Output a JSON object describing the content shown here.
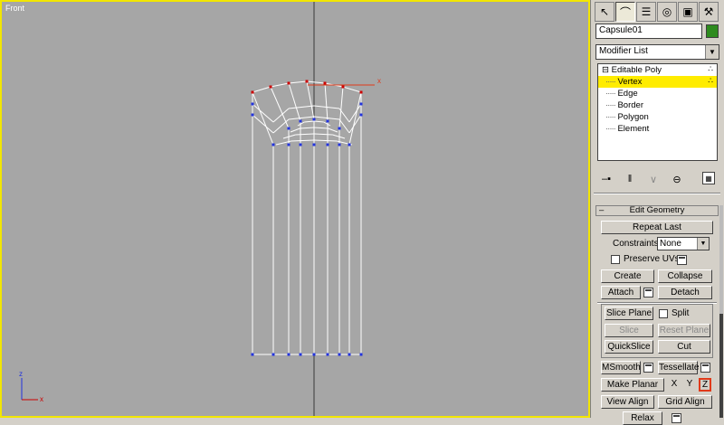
{
  "viewport": {
    "label": "Front",
    "axis_labels": {
      "x": "x",
      "gizmo_x": "x",
      "gizmo_z": "z"
    }
  },
  "panel": {
    "tabs": [
      "create-icon",
      "modify-icon",
      "hierarchy-icon",
      "motion-icon",
      "display-icon",
      "utilities-icon"
    ],
    "object_name": "Capsule01",
    "object_color": "#2e8b1e",
    "modifier_list": "Modifier List",
    "stack": {
      "root": "Editable Poly",
      "items": [
        "Vertex",
        "Edge",
        "Border",
        "Polygon",
        "Element"
      ],
      "selected": "Vertex"
    },
    "rollout": {
      "title": "Edit Geometry",
      "repeat_last": "Repeat Last",
      "constraints_label": "Constraints:",
      "constraints_value": "None",
      "preserve_uvs": "Preserve UVs",
      "create": "Create",
      "collapse": "Collapse",
      "attach": "Attach",
      "detach": "Detach",
      "slice_plane": "Slice Plane",
      "split": "Split",
      "slice": "Slice",
      "reset_plane": "Reset Plane",
      "quickslice": "QuickSlice",
      "cut": "Cut",
      "msmooth": "MSmooth",
      "tessellate": "Tessellate",
      "make_planar": "Make Planar",
      "x": "X",
      "y": "Y",
      "z": "Z",
      "view_align": "View Align",
      "grid_align": "Grid Align",
      "relax": "Relax"
    }
  },
  "colors": {
    "viewport_bg": "#a6a6a6",
    "active_border": "#f2e600",
    "selected_vertex": "#cc0000",
    "unselected_vertex": "#2233dd",
    "stack_highlight": "#ffec00",
    "axis_active": "#e03a1a"
  }
}
